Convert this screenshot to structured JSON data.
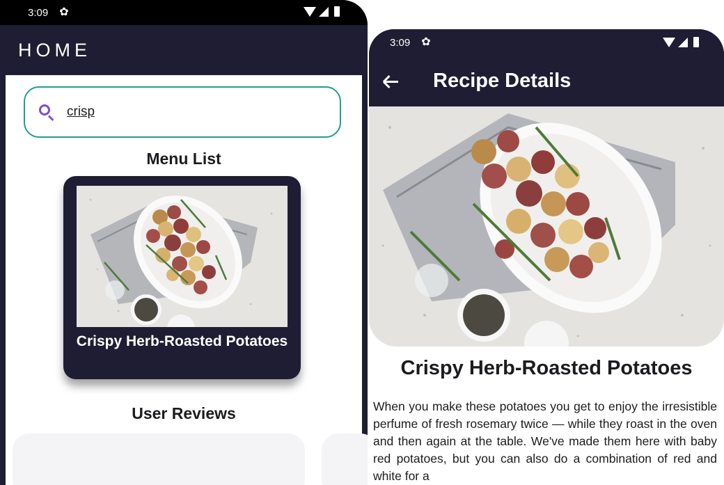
{
  "left_screen": {
    "status_bar": {
      "time": "3:09",
      "settings_icon": "gear-icon"
    },
    "app_bar": {
      "title": "HOME"
    },
    "search": {
      "value": "crisp",
      "icon": "search-icon"
    },
    "menu_list": {
      "heading": "Menu List",
      "items": [
        {
          "title": "Crispy Herb-Roasted Potatoes"
        }
      ]
    },
    "reviews": {
      "heading": "User Reviews"
    }
  },
  "right_screen": {
    "status_bar": {
      "time": "3:09",
      "settings_icon": "gear-icon"
    },
    "app_bar": {
      "title": "Recipe Details",
      "back_icon": "back-arrow-icon"
    },
    "recipe": {
      "title": "Crispy Herb-Roasted Potatoes",
      "description": "When you make these potatoes you get to enjoy the irresistible perfume of fresh rosemary twice — while they roast in the oven and then again at the table. We've made them here with baby red potatoes, but you can also do a combination of red and white for a"
    }
  },
  "colors": {
    "app_bar": "#1e1d33",
    "search_border": "#1f9e8f",
    "search_icon": "#7a4fd6",
    "card_background": "#1e1d33",
    "review_card": "#f4f4f6"
  }
}
